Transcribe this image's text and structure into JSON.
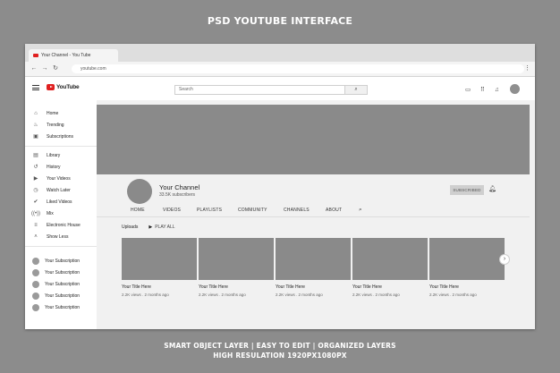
{
  "headline": "PSD YOUTUBE INTERFACE",
  "footer": {
    "line1": "SMART OBJECT LAYER | EASY TO EDIT | ORGANIZED LAYERS",
    "line2": "HIGH RESULATION 1920PX1080PX"
  },
  "browser": {
    "tab_title": "Your Channel - You Tube",
    "url": "youtube.com"
  },
  "header": {
    "logo": "YouTube",
    "search_placeholder": "Search"
  },
  "sidebar": {
    "items": [
      {
        "label": "Home",
        "icon": "home-icon"
      },
      {
        "label": "Trending",
        "icon": "flame-icon"
      },
      {
        "label": "Subscriptions",
        "icon": "subscriptions-icon"
      },
      {
        "label": "Library",
        "icon": "library-icon"
      },
      {
        "label": "History",
        "icon": "history-icon"
      },
      {
        "label": "Your Videos",
        "icon": "play-circle-icon"
      },
      {
        "label": "Watch Later",
        "icon": "clock-icon"
      },
      {
        "label": "Liked Videos",
        "icon": "thumbs-up-icon"
      },
      {
        "label": "Mix",
        "icon": "broadcast-icon"
      },
      {
        "label": "Electronic House",
        "icon": "playlist-icon"
      },
      {
        "label": "Show Less",
        "icon": "chevron-up-icon"
      }
    ],
    "subscriptions": [
      {
        "label": "Your Subscription"
      },
      {
        "label": "Your Subscription"
      },
      {
        "label": "Your Subscription"
      },
      {
        "label": "Your Subscription"
      },
      {
        "label": "Your Subscription"
      }
    ]
  },
  "channel": {
    "name": "Your Channel",
    "subscribers": "33.5K subscribers",
    "subscribed_label": "SUBSCRIBED"
  },
  "tabs": [
    "HOME",
    "VIDEOS",
    "PLAYLISTS",
    "COMMUNITY",
    "CHANNELS",
    "ABOUT"
  ],
  "uploads": {
    "label": "Uploads",
    "play_all": "PLAY ALL"
  },
  "videos": [
    {
      "title": "Your Title Here",
      "meta": "2.2K views . 2 months ago"
    },
    {
      "title": "Your Title Here",
      "meta": "2.2K views . 2 months ago"
    },
    {
      "title": "Your Title Here",
      "meta": "2.2K views . 2 months ago"
    },
    {
      "title": "Your Title Here",
      "meta": "2.2K views . 2 months ago"
    },
    {
      "title": "Your Title Here",
      "meta": "2.2K views . 2 months ago"
    }
  ],
  "colors": {
    "background": "#8c8c8c",
    "placeholder_gray": "#8a8a8a",
    "brand_red": "#e02020"
  }
}
